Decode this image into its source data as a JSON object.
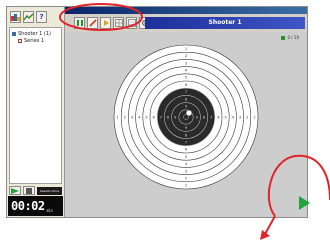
{
  "window": {
    "title": "Shooter 1"
  },
  "left_toolbar": {
    "icons": [
      "group-icon",
      "chart-icon",
      "help-icon"
    ]
  },
  "tree": {
    "items": [
      {
        "label": "Shooter 1 (1)",
        "icon": "shooter-icon"
      },
      {
        "label": "Series 1",
        "icon": "series-icon"
      }
    ]
  },
  "left_bottom": {
    "session_text": "Session time",
    "timer": "00:02",
    "timer_unit": "min"
  },
  "main_toolbar": {
    "tools": [
      "target-view-icon",
      "pencil-icon",
      "arrow-icon",
      "grid-icon",
      "table-icon",
      "settings-icon"
    ],
    "shooter_label": "Shooter 1"
  },
  "target": {
    "ring_numbers": [
      "1",
      "2",
      "3",
      "4",
      "5",
      "6",
      "7",
      "8",
      "9",
      "10"
    ],
    "shot_count": "0 / 10"
  },
  "colors": {
    "accent_green": "#1fa53a",
    "title_blue": "#2a3fb0",
    "annotation_red": "#e0242a",
    "target_black": "#2a2a2a"
  }
}
